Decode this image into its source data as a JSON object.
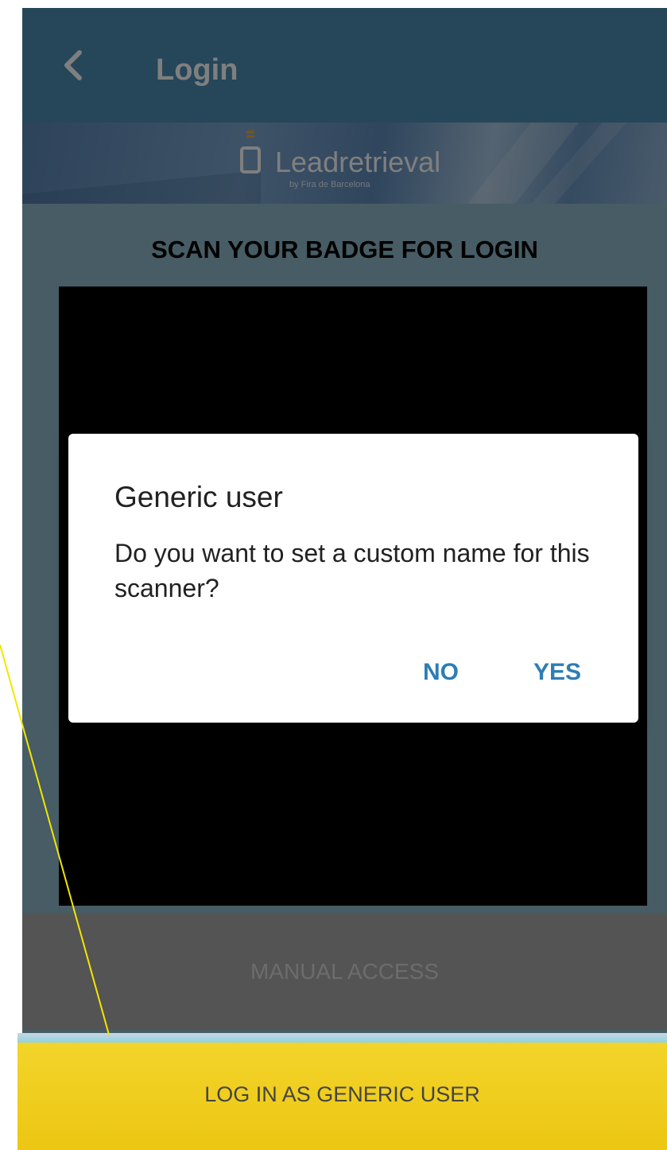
{
  "appbar": {
    "title": "Login",
    "back_icon": "chevron-left-icon",
    "color": "#4a8fb3"
  },
  "banner": {
    "logo_icon": "battery-icon",
    "logo_text": "Leadretrieval",
    "logo_subtext": "by Fira de Barcelona"
  },
  "main": {
    "scan_title": "SCAN YOUR BADGE FOR LOGIN",
    "manual_access_label": "MANUAL ACCESS"
  },
  "dialog": {
    "title": "Generic user",
    "message": "Do you want to set a custom name for this scanner?",
    "no_label": "NO",
    "yes_label": "YES",
    "accent_color": "#2e7db5"
  },
  "bottom": {
    "generic_login_label": "LOG IN AS GENERIC USER",
    "color": "#f3d42a"
  }
}
